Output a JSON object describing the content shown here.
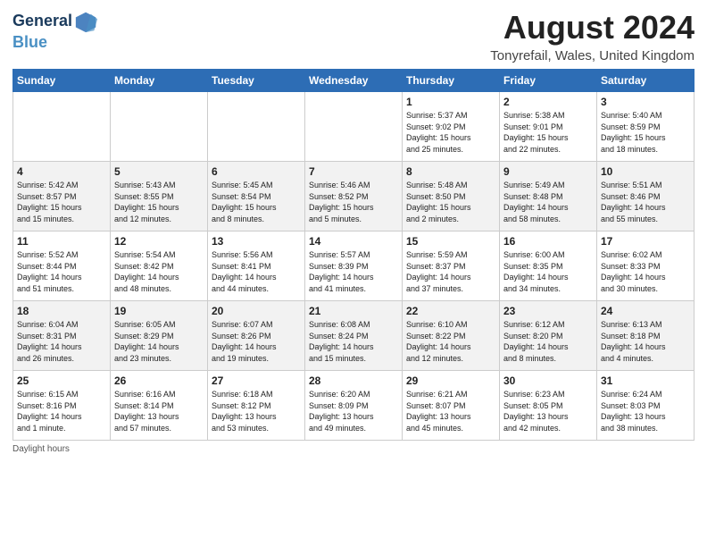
{
  "header": {
    "logo_line1": "General",
    "logo_line2": "Blue",
    "month_year": "August 2024",
    "location": "Tonyrefail, Wales, United Kingdom"
  },
  "days_of_week": [
    "Sunday",
    "Monday",
    "Tuesday",
    "Wednesday",
    "Thursday",
    "Friday",
    "Saturday"
  ],
  "weeks": [
    [
      {
        "day": "",
        "info": ""
      },
      {
        "day": "",
        "info": ""
      },
      {
        "day": "",
        "info": ""
      },
      {
        "day": "",
        "info": ""
      },
      {
        "day": "1",
        "info": "Sunrise: 5:37 AM\nSunset: 9:02 PM\nDaylight: 15 hours\nand 25 minutes."
      },
      {
        "day": "2",
        "info": "Sunrise: 5:38 AM\nSunset: 9:01 PM\nDaylight: 15 hours\nand 22 minutes."
      },
      {
        "day": "3",
        "info": "Sunrise: 5:40 AM\nSunset: 8:59 PM\nDaylight: 15 hours\nand 18 minutes."
      }
    ],
    [
      {
        "day": "4",
        "info": "Sunrise: 5:42 AM\nSunset: 8:57 PM\nDaylight: 15 hours\nand 15 minutes."
      },
      {
        "day": "5",
        "info": "Sunrise: 5:43 AM\nSunset: 8:55 PM\nDaylight: 15 hours\nand 12 minutes."
      },
      {
        "day": "6",
        "info": "Sunrise: 5:45 AM\nSunset: 8:54 PM\nDaylight: 15 hours\nand 8 minutes."
      },
      {
        "day": "7",
        "info": "Sunrise: 5:46 AM\nSunset: 8:52 PM\nDaylight: 15 hours\nand 5 minutes."
      },
      {
        "day": "8",
        "info": "Sunrise: 5:48 AM\nSunset: 8:50 PM\nDaylight: 15 hours\nand 2 minutes."
      },
      {
        "day": "9",
        "info": "Sunrise: 5:49 AM\nSunset: 8:48 PM\nDaylight: 14 hours\nand 58 minutes."
      },
      {
        "day": "10",
        "info": "Sunrise: 5:51 AM\nSunset: 8:46 PM\nDaylight: 14 hours\nand 55 minutes."
      }
    ],
    [
      {
        "day": "11",
        "info": "Sunrise: 5:52 AM\nSunset: 8:44 PM\nDaylight: 14 hours\nand 51 minutes."
      },
      {
        "day": "12",
        "info": "Sunrise: 5:54 AM\nSunset: 8:42 PM\nDaylight: 14 hours\nand 48 minutes."
      },
      {
        "day": "13",
        "info": "Sunrise: 5:56 AM\nSunset: 8:41 PM\nDaylight: 14 hours\nand 44 minutes."
      },
      {
        "day": "14",
        "info": "Sunrise: 5:57 AM\nSunset: 8:39 PM\nDaylight: 14 hours\nand 41 minutes."
      },
      {
        "day": "15",
        "info": "Sunrise: 5:59 AM\nSunset: 8:37 PM\nDaylight: 14 hours\nand 37 minutes."
      },
      {
        "day": "16",
        "info": "Sunrise: 6:00 AM\nSunset: 8:35 PM\nDaylight: 14 hours\nand 34 minutes."
      },
      {
        "day": "17",
        "info": "Sunrise: 6:02 AM\nSunset: 8:33 PM\nDaylight: 14 hours\nand 30 minutes."
      }
    ],
    [
      {
        "day": "18",
        "info": "Sunrise: 6:04 AM\nSunset: 8:31 PM\nDaylight: 14 hours\nand 26 minutes."
      },
      {
        "day": "19",
        "info": "Sunrise: 6:05 AM\nSunset: 8:29 PM\nDaylight: 14 hours\nand 23 minutes."
      },
      {
        "day": "20",
        "info": "Sunrise: 6:07 AM\nSunset: 8:26 PM\nDaylight: 14 hours\nand 19 minutes."
      },
      {
        "day": "21",
        "info": "Sunrise: 6:08 AM\nSunset: 8:24 PM\nDaylight: 14 hours\nand 15 minutes."
      },
      {
        "day": "22",
        "info": "Sunrise: 6:10 AM\nSunset: 8:22 PM\nDaylight: 14 hours\nand 12 minutes."
      },
      {
        "day": "23",
        "info": "Sunrise: 6:12 AM\nSunset: 8:20 PM\nDaylight: 14 hours\nand 8 minutes."
      },
      {
        "day": "24",
        "info": "Sunrise: 6:13 AM\nSunset: 8:18 PM\nDaylight: 14 hours\nand 4 minutes."
      }
    ],
    [
      {
        "day": "25",
        "info": "Sunrise: 6:15 AM\nSunset: 8:16 PM\nDaylight: 14 hours\nand 1 minute."
      },
      {
        "day": "26",
        "info": "Sunrise: 6:16 AM\nSunset: 8:14 PM\nDaylight: 13 hours\nand 57 minutes."
      },
      {
        "day": "27",
        "info": "Sunrise: 6:18 AM\nSunset: 8:12 PM\nDaylight: 13 hours\nand 53 minutes."
      },
      {
        "day": "28",
        "info": "Sunrise: 6:20 AM\nSunset: 8:09 PM\nDaylight: 13 hours\nand 49 minutes."
      },
      {
        "day": "29",
        "info": "Sunrise: 6:21 AM\nSunset: 8:07 PM\nDaylight: 13 hours\nand 45 minutes."
      },
      {
        "day": "30",
        "info": "Sunrise: 6:23 AM\nSunset: 8:05 PM\nDaylight: 13 hours\nand 42 minutes."
      },
      {
        "day": "31",
        "info": "Sunrise: 6:24 AM\nSunset: 8:03 PM\nDaylight: 13 hours\nand 38 minutes."
      }
    ]
  ],
  "footer": {
    "note": "Daylight hours"
  }
}
